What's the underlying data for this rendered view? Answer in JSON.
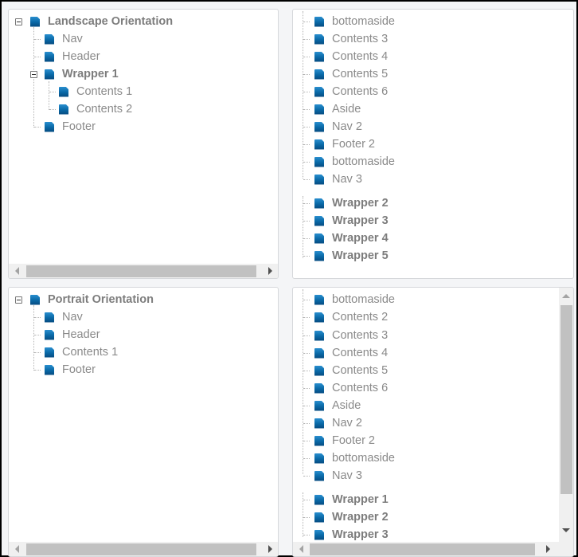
{
  "panels": {
    "landscape": {
      "root": {
        "label": "Landscape Orientation",
        "expanded": true
      },
      "children": [
        {
          "label": "Nav"
        },
        {
          "label": "Header"
        },
        {
          "label": "Wrapper 1",
          "expanded": true,
          "children": [
            {
              "label": "Contents 1"
            },
            {
              "label": "Contents 2"
            }
          ]
        },
        {
          "label": "Footer"
        }
      ]
    },
    "landscape_right": {
      "items": [
        "bottomaside",
        "Contents 3",
        "Contents 4",
        "Contents 5",
        "Contents 6",
        "Aside",
        "Nav 2",
        "Footer 2",
        "bottomaside",
        "Nav 3"
      ],
      "wrappers": [
        "Wrapper 2",
        "Wrapper 3",
        "Wrapper 4",
        "Wrapper 5"
      ]
    },
    "portrait": {
      "root": {
        "label": "Portrait Orientation",
        "expanded": true
      },
      "children": [
        {
          "label": "Nav"
        },
        {
          "label": "Header"
        },
        {
          "label": "Contents 1"
        },
        {
          "label": "Footer"
        }
      ]
    },
    "portrait_right": {
      "items": [
        "bottomaside",
        "Contents 2",
        "Contents 3",
        "Contents 4",
        "Contents 5",
        "Contents 6",
        "Aside",
        "Nav 2",
        "Footer 2",
        "bottomaside",
        "Nav 3"
      ],
      "wrappers": [
        "Wrapper 1",
        "Wrapper 2",
        "Wrapper 3"
      ]
    }
  },
  "colors": {
    "icon": "#0a6aa8",
    "text": "#8a8a8a",
    "background": "#f4f5f7"
  }
}
